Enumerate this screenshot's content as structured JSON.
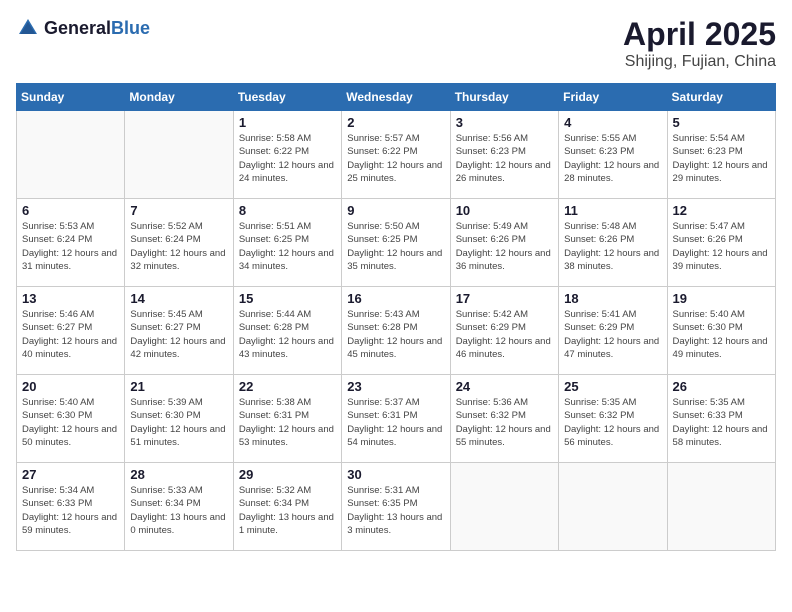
{
  "header": {
    "logo_general": "General",
    "logo_blue": "Blue",
    "month_title": "April 2025",
    "location": "Shijing, Fujian, China"
  },
  "weekdays": [
    "Sunday",
    "Monday",
    "Tuesday",
    "Wednesday",
    "Thursday",
    "Friday",
    "Saturday"
  ],
  "weeks": [
    [
      {
        "day": "",
        "detail": ""
      },
      {
        "day": "",
        "detail": ""
      },
      {
        "day": "1",
        "detail": "Sunrise: 5:58 AM\nSunset: 6:22 PM\nDaylight: 12 hours and 24 minutes."
      },
      {
        "day": "2",
        "detail": "Sunrise: 5:57 AM\nSunset: 6:22 PM\nDaylight: 12 hours and 25 minutes."
      },
      {
        "day": "3",
        "detail": "Sunrise: 5:56 AM\nSunset: 6:23 PM\nDaylight: 12 hours and 26 minutes."
      },
      {
        "day": "4",
        "detail": "Sunrise: 5:55 AM\nSunset: 6:23 PM\nDaylight: 12 hours and 28 minutes."
      },
      {
        "day": "5",
        "detail": "Sunrise: 5:54 AM\nSunset: 6:23 PM\nDaylight: 12 hours and 29 minutes."
      }
    ],
    [
      {
        "day": "6",
        "detail": "Sunrise: 5:53 AM\nSunset: 6:24 PM\nDaylight: 12 hours and 31 minutes."
      },
      {
        "day": "7",
        "detail": "Sunrise: 5:52 AM\nSunset: 6:24 PM\nDaylight: 12 hours and 32 minutes."
      },
      {
        "day": "8",
        "detail": "Sunrise: 5:51 AM\nSunset: 6:25 PM\nDaylight: 12 hours and 34 minutes."
      },
      {
        "day": "9",
        "detail": "Sunrise: 5:50 AM\nSunset: 6:25 PM\nDaylight: 12 hours and 35 minutes."
      },
      {
        "day": "10",
        "detail": "Sunrise: 5:49 AM\nSunset: 6:26 PM\nDaylight: 12 hours and 36 minutes."
      },
      {
        "day": "11",
        "detail": "Sunrise: 5:48 AM\nSunset: 6:26 PM\nDaylight: 12 hours and 38 minutes."
      },
      {
        "day": "12",
        "detail": "Sunrise: 5:47 AM\nSunset: 6:26 PM\nDaylight: 12 hours and 39 minutes."
      }
    ],
    [
      {
        "day": "13",
        "detail": "Sunrise: 5:46 AM\nSunset: 6:27 PM\nDaylight: 12 hours and 40 minutes."
      },
      {
        "day": "14",
        "detail": "Sunrise: 5:45 AM\nSunset: 6:27 PM\nDaylight: 12 hours and 42 minutes."
      },
      {
        "day": "15",
        "detail": "Sunrise: 5:44 AM\nSunset: 6:28 PM\nDaylight: 12 hours and 43 minutes."
      },
      {
        "day": "16",
        "detail": "Sunrise: 5:43 AM\nSunset: 6:28 PM\nDaylight: 12 hours and 45 minutes."
      },
      {
        "day": "17",
        "detail": "Sunrise: 5:42 AM\nSunset: 6:29 PM\nDaylight: 12 hours and 46 minutes."
      },
      {
        "day": "18",
        "detail": "Sunrise: 5:41 AM\nSunset: 6:29 PM\nDaylight: 12 hours and 47 minutes."
      },
      {
        "day": "19",
        "detail": "Sunrise: 5:40 AM\nSunset: 6:30 PM\nDaylight: 12 hours and 49 minutes."
      }
    ],
    [
      {
        "day": "20",
        "detail": "Sunrise: 5:40 AM\nSunset: 6:30 PM\nDaylight: 12 hours and 50 minutes."
      },
      {
        "day": "21",
        "detail": "Sunrise: 5:39 AM\nSunset: 6:30 PM\nDaylight: 12 hours and 51 minutes."
      },
      {
        "day": "22",
        "detail": "Sunrise: 5:38 AM\nSunset: 6:31 PM\nDaylight: 12 hours and 53 minutes."
      },
      {
        "day": "23",
        "detail": "Sunrise: 5:37 AM\nSunset: 6:31 PM\nDaylight: 12 hours and 54 minutes."
      },
      {
        "day": "24",
        "detail": "Sunrise: 5:36 AM\nSunset: 6:32 PM\nDaylight: 12 hours and 55 minutes."
      },
      {
        "day": "25",
        "detail": "Sunrise: 5:35 AM\nSunset: 6:32 PM\nDaylight: 12 hours and 56 minutes."
      },
      {
        "day": "26",
        "detail": "Sunrise: 5:35 AM\nSunset: 6:33 PM\nDaylight: 12 hours and 58 minutes."
      }
    ],
    [
      {
        "day": "27",
        "detail": "Sunrise: 5:34 AM\nSunset: 6:33 PM\nDaylight: 12 hours and 59 minutes."
      },
      {
        "day": "28",
        "detail": "Sunrise: 5:33 AM\nSunset: 6:34 PM\nDaylight: 13 hours and 0 minutes."
      },
      {
        "day": "29",
        "detail": "Sunrise: 5:32 AM\nSunset: 6:34 PM\nDaylight: 13 hours and 1 minute."
      },
      {
        "day": "30",
        "detail": "Sunrise: 5:31 AM\nSunset: 6:35 PM\nDaylight: 13 hours and 3 minutes."
      },
      {
        "day": "",
        "detail": ""
      },
      {
        "day": "",
        "detail": ""
      },
      {
        "day": "",
        "detail": ""
      }
    ]
  ]
}
